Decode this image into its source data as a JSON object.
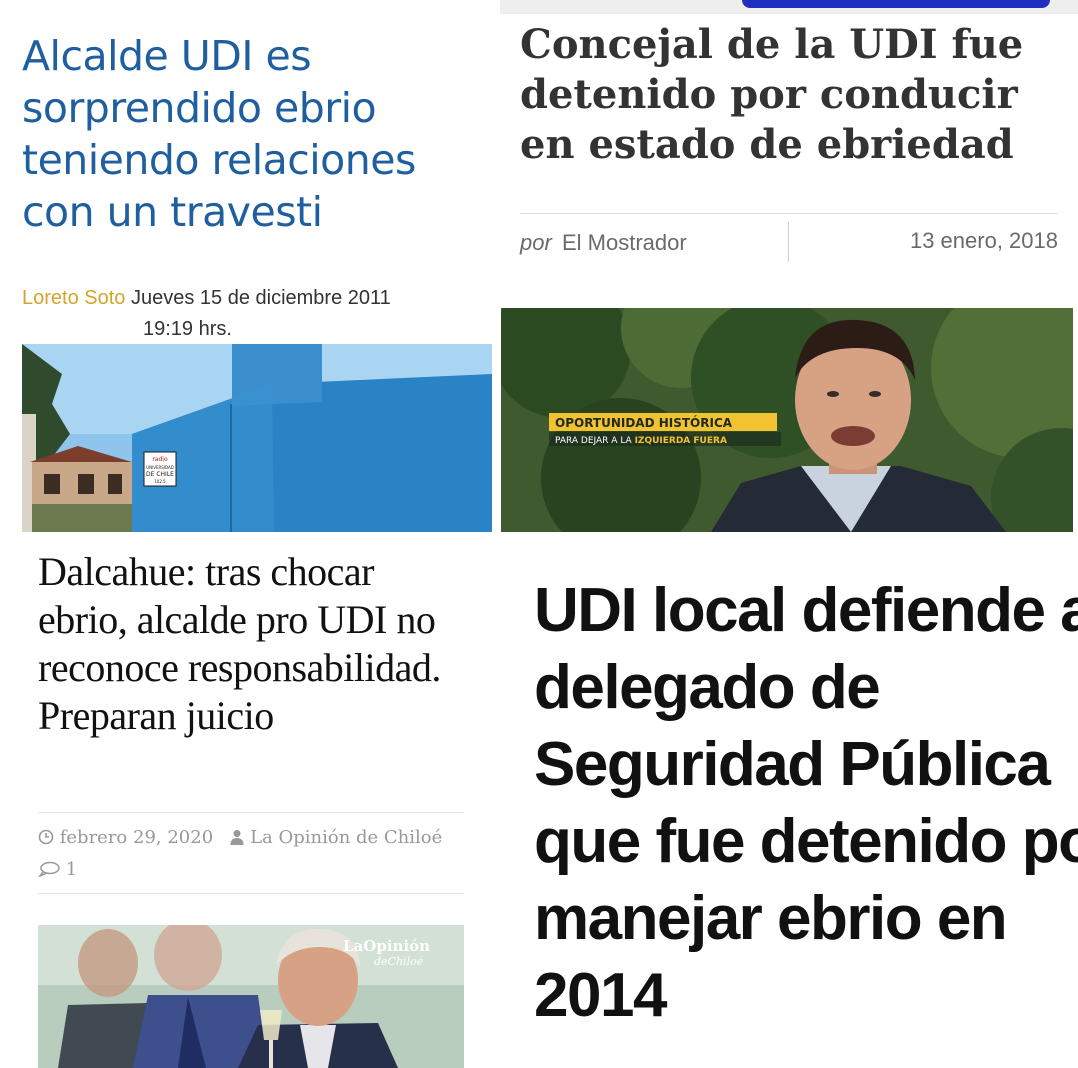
{
  "top_left": {
    "headline": "Alcalde UDI es sorprendido ebrio teniendo relaciones con un travesti",
    "author": "Loreto Soto",
    "date": "Jueves 15 de diciembre 2011",
    "time": "19:19 hrs.",
    "photo_sign": "radio UNIVERSIDAD DE CHILE 102.5",
    "colors": {
      "headline": "#1f5fa0",
      "author": "#d4a52b"
    }
  },
  "top_right": {
    "headline": "Concejal de la UDI fue detenido por conducir en estado de ebriedad",
    "by_prefix": "por",
    "source": "El Mostrador",
    "date": "13 enero, 2018",
    "banner_title": "OPORTUNIDAD HISTÓRICA",
    "banner_subtitle_prefix": "PARA DEJAR A LA",
    "banner_subtitle_highlight": "IZQUIERDA FUERA"
  },
  "bottom_left": {
    "headline": "Dalcahue: tras chocar ebrio, alcalde pro UDI no reconoce responsabilidad. Preparan juicio",
    "date": "febrero 29, 2020",
    "author": "La Opinión de Chiloé",
    "comments": "1",
    "icons": [
      "clock-icon",
      "user-icon",
      "comment-icon"
    ],
    "watermark_line1": "LaOpinión",
    "watermark_line2": "deChiloé"
  },
  "bottom_right": {
    "headline_lines": [
      "UDI local defiende a",
      "delegado de",
      "Seguridad Pública",
      "que fue detenido por",
      "manejar ebrio en",
      "2014"
    ]
  }
}
